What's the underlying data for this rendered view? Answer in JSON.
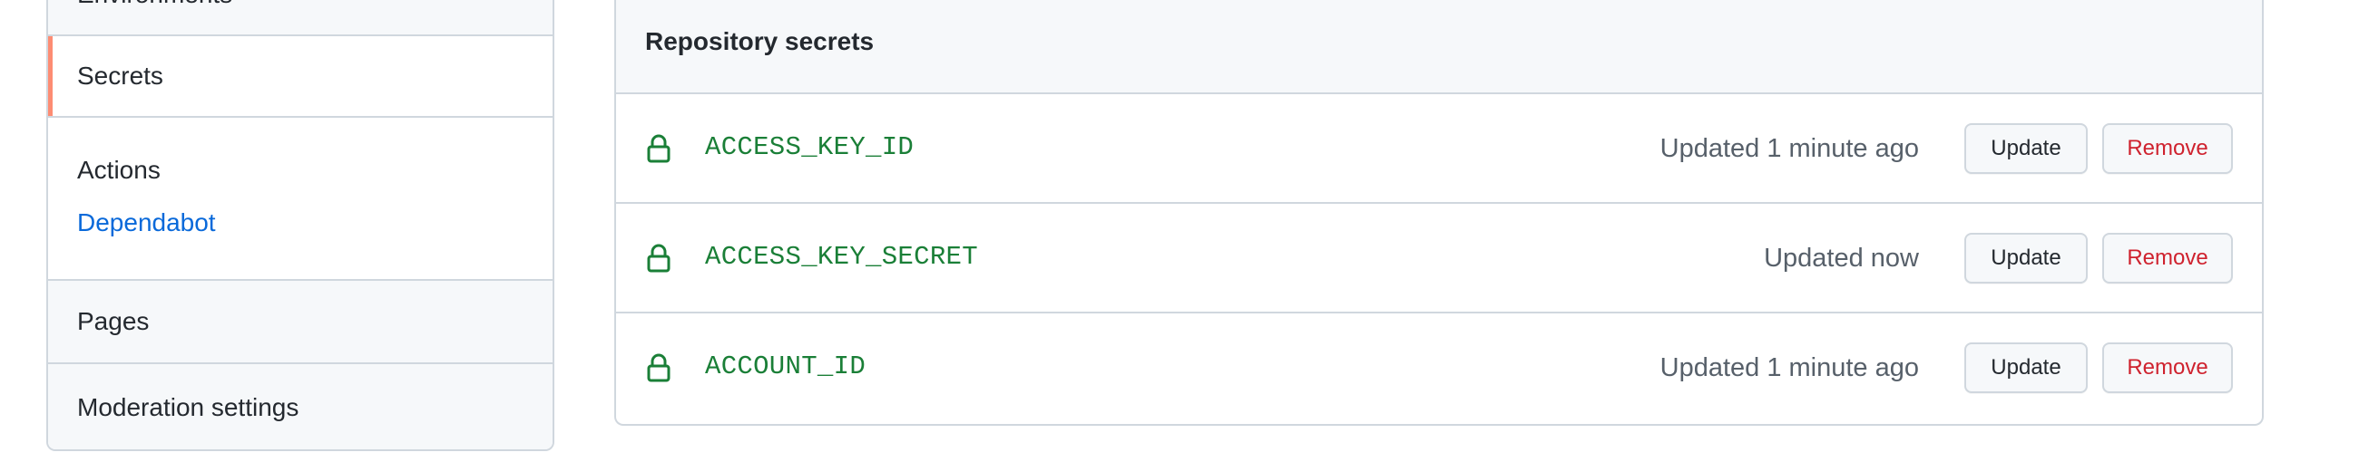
{
  "sidebar": {
    "environments_label": "Environments",
    "secrets_label": "Secrets",
    "actions_label": "Actions",
    "dependabot_label": "Dependabot",
    "pages_label": "Pages",
    "moderation_label": "Moderation settings"
  },
  "panel": {
    "title": "Repository secrets",
    "secrets": [
      {
        "name": "ACCESS_KEY_ID",
        "updated": "Updated 1 minute ago",
        "update_label": "Update",
        "remove_label": "Remove",
        "icon": "lock-icon"
      },
      {
        "name": "ACCESS_KEY_SECRET",
        "updated": "Updated now",
        "update_label": "Update",
        "remove_label": "Remove",
        "icon": "lock-icon"
      },
      {
        "name": "ACCOUNT_ID",
        "updated": "Updated 1 minute ago",
        "update_label": "Update",
        "remove_label": "Remove",
        "icon": "lock-icon"
      }
    ]
  },
  "colors": {
    "active_indicator": "#fd8c73",
    "secret_name": "#1a7f37",
    "link": "#0969da",
    "danger": "#cf222e",
    "border": "#d0d7de"
  }
}
